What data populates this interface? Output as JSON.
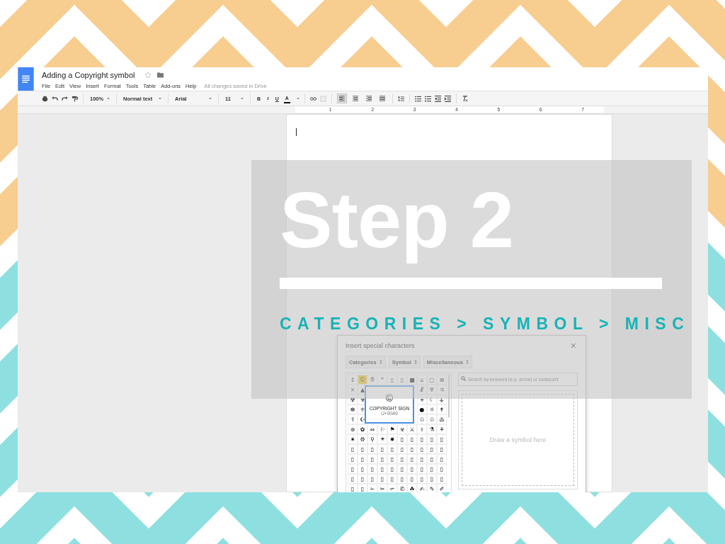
{
  "document": {
    "title": "Adding a Copyright symbol",
    "menu": [
      "File",
      "Edit",
      "View",
      "Insert",
      "Format",
      "Tools",
      "Table",
      "Add-ons",
      "Help"
    ],
    "status": "All changes saved in Drive"
  },
  "toolbar": {
    "zoom": "100%",
    "style": "Normal text",
    "font": "Arial",
    "size": "11",
    "format": [
      "B",
      "I",
      "U",
      "A"
    ],
    "alignments": [
      {
        "selected": true
      },
      {
        "selected": false
      },
      {
        "selected": false
      },
      {
        "selected": false
      }
    ]
  },
  "ruler": [
    "1",
    "2",
    "3",
    "4",
    "5",
    "6",
    "7"
  ],
  "overlay": {
    "heading": "Step 2",
    "subheading": "CATEGORIES > SYMBOL > MISC"
  },
  "dialog": {
    "title": "Insert special characters",
    "close": "×",
    "selects": [
      "Categories",
      "Symbol",
      "Miscellaneous"
    ],
    "search": {
      "placeholder": "Search by keyword (e.g. arrow) or codepoint"
    },
    "draw_hint": "Draw a symbol here",
    "grid": [
      {
        "cells": [
          {
            "char": "↕",
            "selected": false
          },
          {
            "char": "©",
            "selected": true
          },
          {
            "char": "®",
            "selected": false
          },
          {
            "char": "*",
            "selected": false
          },
          {
            "char": "▯",
            "selected": false
          },
          {
            "char": "▯",
            "selected": false
          },
          {
            "char": "■",
            "selected": false
          },
          {
            "char": "⌂",
            "selected": false
          },
          {
            "char": "▢",
            "selected": false
          },
          {
            "char": "⊠",
            "selected": false
          }
        ]
      },
      {
        "left": [
          {
            "char": "×",
            "selected": false
          },
          {
            "char": "▲",
            "selected": false
          }
        ],
        "right": [
          {
            "char": "☧",
            "selected": false
          },
          {
            "char": "♅",
            "selected": false
          },
          {
            "char": "♃",
            "selected": false
          }
        ]
      },
      {
        "left": [
          {
            "char": "☢",
            "selected": false
          },
          {
            "char": "☣",
            "selected": false
          }
        ],
        "right": [
          {
            "char": "+",
            "selected": false
          },
          {
            "char": "☾",
            "selected": false
          },
          {
            "char": "⚶",
            "selected": false
          }
        ]
      },
      {
        "left": [
          {
            "char": "☸",
            "selected": false
          },
          {
            "char": "☥",
            "selected": false
          }
        ],
        "right": [
          {
            "char": "●",
            "selected": false
          },
          {
            "char": "☼",
            "selected": false
          },
          {
            "char": "✝",
            "selected": false
          }
        ]
      },
      {
        "left": [
          {
            "char": "☦",
            "selected": false
          },
          {
            "char": "☪",
            "selected": false
          }
        ],
        "right": [
          {
            "char": "♲",
            "selected": false
          },
          {
            "char": "♲",
            "selected": false
          },
          {
            "char": "♳",
            "selected": false
          }
        ]
      },
      {
        "cells": [
          {
            "char": "⊛",
            "selected": false
          },
          {
            "char": "✿",
            "selected": false
          },
          {
            "char": "⇔",
            "selected": false
          },
          {
            "char": "⚐",
            "selected": false
          },
          {
            "char": "⚑",
            "selected": false
          },
          {
            "char": "☣",
            "selected": false
          },
          {
            "char": "⚔",
            "selected": false
          },
          {
            "char": "⚕",
            "selected": false
          },
          {
            "char": "⚗",
            "selected": false
          },
          {
            "char": "⚘",
            "selected": false
          }
        ]
      },
      {
        "cells": [
          {
            "char": "✷",
            "selected": false
          },
          {
            "char": "⚙",
            "selected": false
          },
          {
            "char": "⚲",
            "selected": false
          },
          {
            "char": "⚹",
            "selected": false
          },
          {
            "char": "✸",
            "selected": false
          },
          {
            "char": "▯",
            "selected": false
          },
          {
            "char": "▯",
            "selected": false
          },
          {
            "char": "▯",
            "selected": false
          },
          {
            "char": "▯",
            "selected": false
          },
          {
            "char": "▯",
            "selected": false
          }
        ]
      },
      {
        "cells": [
          {
            "char": "▯",
            "selected": false
          },
          {
            "char": "▯",
            "selected": false
          },
          {
            "char": "▯",
            "selected": false
          },
          {
            "char": "▯",
            "selected": false
          },
          {
            "char": "▯",
            "selected": false
          },
          {
            "char": "▯",
            "selected": false
          },
          {
            "char": "▯",
            "selected": false
          },
          {
            "char": "▯",
            "selected": false
          },
          {
            "char": "▯",
            "selected": false
          },
          {
            "char": "▯",
            "selected": false
          }
        ]
      },
      {
        "cells": [
          {
            "char": "▯",
            "selected": false
          },
          {
            "char": "▯",
            "selected": false
          },
          {
            "char": "▯",
            "selected": false
          },
          {
            "char": "▯",
            "selected": false
          },
          {
            "char": "▯",
            "selected": false
          },
          {
            "char": "▯",
            "selected": false
          },
          {
            "char": "▯",
            "selected": false
          },
          {
            "char": "▯",
            "selected": false
          },
          {
            "char": "▯",
            "selected": false
          },
          {
            "char": "▯",
            "selected": false
          }
        ]
      },
      {
        "cells": [
          {
            "char": "▯",
            "selected": false
          },
          {
            "char": "▯",
            "selected": false
          },
          {
            "char": "▯",
            "selected": false
          },
          {
            "char": "▯",
            "selected": false
          },
          {
            "char": "▯",
            "selected": false
          },
          {
            "char": "▯",
            "selected": false
          },
          {
            "char": "▯",
            "selected": false
          },
          {
            "char": "▯",
            "selected": false
          },
          {
            "char": "▯",
            "selected": false
          },
          {
            "char": "▯",
            "selected": false
          }
        ]
      },
      {
        "cells": [
          {
            "char": "▯",
            "selected": false
          },
          {
            "char": "▯",
            "selected": false
          },
          {
            "char": "▯",
            "selected": false
          },
          {
            "char": "▯",
            "selected": false
          },
          {
            "char": "▯",
            "selected": false
          },
          {
            "char": "▯",
            "selected": false
          },
          {
            "char": "▯",
            "selected": false
          },
          {
            "char": "▯",
            "selected": false
          },
          {
            "char": "▯",
            "selected": false
          },
          {
            "char": "▯",
            "selected": false
          }
        ]
      },
      {
        "cells": [
          {
            "char": "▯",
            "selected": false
          },
          {
            "char": "▯",
            "selected": false
          },
          {
            "char": "✁",
            "selected": false
          },
          {
            "char": "✂",
            "selected": false
          },
          {
            "char": "✃",
            "selected": false
          },
          {
            "char": "✆",
            "selected": false
          },
          {
            "char": "☘",
            "selected": false
          },
          {
            "char": "✍",
            "selected": false
          },
          {
            "char": "✎",
            "selected": false
          },
          {
            "char": "✐",
            "selected": false
          }
        ]
      }
    ],
    "tooltip": {
      "symbol": "©",
      "name": "COPYRIGHT SIGN",
      "code": "U+00A9"
    }
  }
}
